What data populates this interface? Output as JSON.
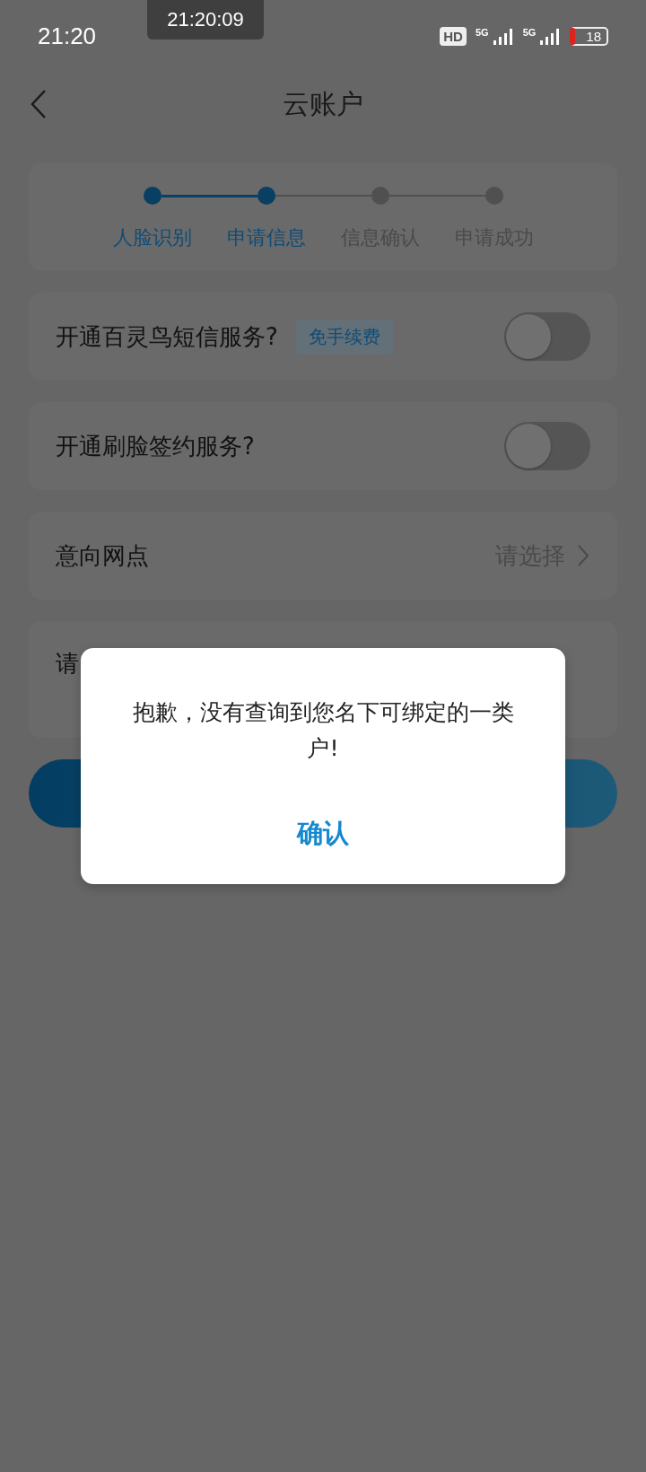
{
  "status_bar": {
    "time": "21:20",
    "clock_popup": "21:20:09",
    "hd_label": "HD",
    "networks": [
      "5G",
      "5G"
    ],
    "battery": "18"
  },
  "header": {
    "title": "云账户"
  },
  "steps": [
    {
      "label": "人脸识别",
      "done": true
    },
    {
      "label": "申请信息",
      "done": true
    },
    {
      "label": "信息确认",
      "done": false
    },
    {
      "label": "申请成功",
      "done": false
    }
  ],
  "options": [
    {
      "kind": "toggle",
      "label": "开通百灵鸟短信服务?",
      "tag": "免手续费",
      "on": false
    },
    {
      "kind": "toggle",
      "label": "开通刷脸签约服务?",
      "on": false
    },
    {
      "kind": "select",
      "label": "意向网点",
      "value": "请选择"
    },
    {
      "kind": "text",
      "label": "请"
    }
  ],
  "dialog": {
    "message": "抱歉，没有查询到您名下可绑定的一类户!",
    "button": "确认"
  }
}
